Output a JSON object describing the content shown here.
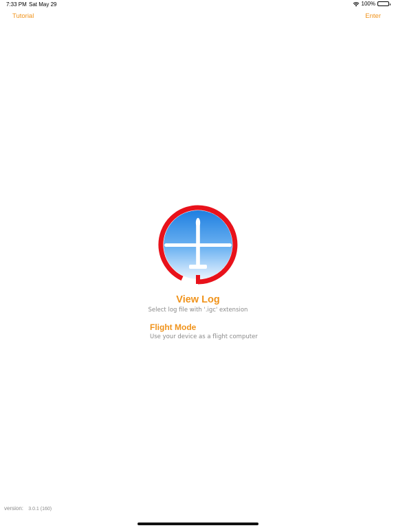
{
  "status_bar": {
    "time": "7:33 PM",
    "date": "Sat May 29",
    "battery": "100%",
    "battery_level": 1.0
  },
  "nav": {
    "left_label": "Tutorial",
    "right_label": "Enter"
  },
  "logo": {
    "icon": "glider-icon",
    "ring_color": "#E8121B",
    "sky_top_color": "#1F7FE0",
    "sky_bottom_color": "#EAF4FF"
  },
  "options": {
    "view_log": {
      "title": "View Log",
      "subtitle": "Select log file with '.igc' extension"
    },
    "flight_mode": {
      "title": "Flight Mode",
      "subtitle": "Use your device as a flight computer"
    }
  },
  "footer": {
    "version_label": "version:",
    "version_value": "3.0.1 (160)"
  },
  "colors": {
    "accent": "#F0931B",
    "secondary_text": "#8a8a8a"
  }
}
